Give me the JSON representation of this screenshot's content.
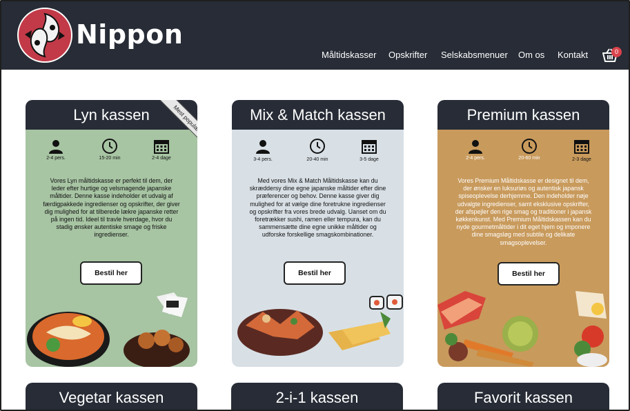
{
  "brand": {
    "name": "Nippon"
  },
  "nav": {
    "items": [
      "Måltidskasser",
      "Opskrifter",
      "Selskabsmenuer",
      "Om os",
      "Kontakt"
    ]
  },
  "cart": {
    "count": "0"
  },
  "cards": [
    {
      "title": "Lyn kassen",
      "ribbon": "Mest populære",
      "bg": "#a7c4a3",
      "persons": "2-4 pers.",
      "time": "15-20 min",
      "days": "2-4 dage",
      "description": "Vores Lyn måltidskasse er perfekt til dem, der leder efter hurtige og velsmagende japanske måltider. Denne kasse indeholder et udvalg af færdigpakkede ingredienser og opskrifter, der giver dig mulighed for at tilberede lækre japanske retter på ingen tid. Ideel til travle hverdage, hvor du stadig ønsker autentiske smage og friske ingredienser.",
      "button": "Bestil her"
    },
    {
      "title": "Mix & Match kassen",
      "bg": "#d8e0e6",
      "persons": "3-4 pers.",
      "time": "20-40 min",
      "days": "3-5 dage",
      "description": "Med vores Mix & Match Måltidskasse kan du skræddersy dine egne japanske måltider efter dine præferencer og behov. Denne kasse giver dig mulighed for at vælge dine foretrukne ingredienser og opskrifter fra vores brede udvalg. Uanset om du foretrækker sushi, ramen eller tempura, kan du sammensætte dine egne unikke måltider og udforske forskellige smagskombinationer.",
      "button": "Bestil her"
    },
    {
      "title": "Premium kassen",
      "bg": "#c89a5c",
      "persons": "2-4 pers.",
      "time": "20-60 min",
      "days": "2-3 dage",
      "description": "Vores Premium Måltidskasse er designet til dem, der ønsker en luksuriøs og autentisk japansk spiseoplevelse derhjemme. Den indeholder nøje udvalgte ingredienser, samt eksklusive opskrifter, der afspejler den rige smag og traditioner i japansk køkkenkunst. Med Premium Måltidskassen kan du nyde gourmetmåltider i dit eget hjem og imponere dine smagsløg med subtile og delikate smagsoplevelser.",
      "button": "Bestil her"
    }
  ],
  "more_cards": [
    "Vegetar kassen",
    "2-i-1 kassen",
    "Favorit kassen"
  ],
  "colors": {
    "header": "#272c36",
    "accent": "#d9434c"
  }
}
